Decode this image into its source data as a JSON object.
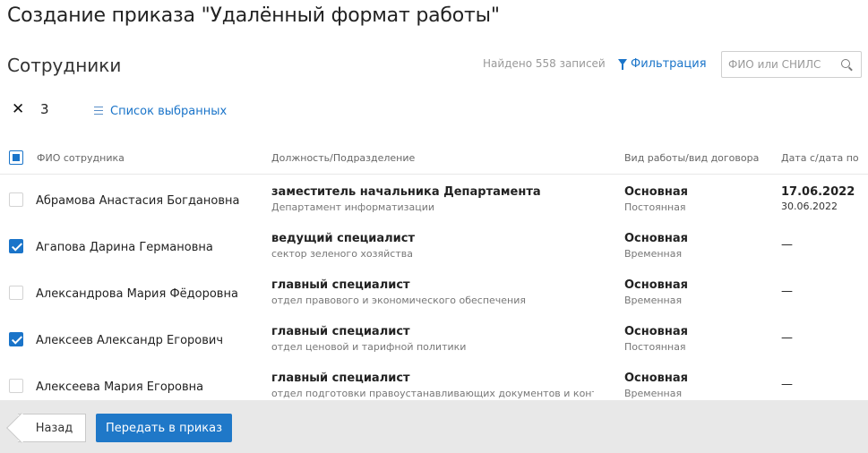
{
  "page": {
    "title": "Создание приказа \"Удалённый формат работы\"",
    "section_title": "Сотрудники"
  },
  "toolbar": {
    "found_text": "Найдено 558 записей",
    "filter_label": "Фильтрация",
    "search_placeholder": "ФИО или СНИЛС",
    "selected_count": "3",
    "selected_list_label": "Список выбранных"
  },
  "table": {
    "headers": {
      "name": "ФИО сотрудника",
      "position": "Должность/Подразделение",
      "work_type": "Вид работы/вид договора",
      "dates": "Дата с/дата по"
    },
    "rows": [
      {
        "checked": false,
        "name": "Абрамова Анастасия Богдановна",
        "position": "заместитель начальника Департамента",
        "department": "Департамент информатизации",
        "work_type": "Основная",
        "contract": "Постоянная",
        "date_from": "17.06.2022",
        "date_to": "30.06.2022"
      },
      {
        "checked": true,
        "name": "Агапова Дарина Германовна",
        "position": "ведущий специалист",
        "department": "сектор зеленого хозяйства",
        "work_type": "Основная",
        "contract": "Временная",
        "date_from": "—"
      },
      {
        "checked": false,
        "name": "Александрова Мария Фёдоровна",
        "position": "главный специалист",
        "department": "отдел правового и экономического обеспечения",
        "work_type": "Основная",
        "contract": "Временная",
        "date_from": "—"
      },
      {
        "checked": true,
        "name": "Алексеев Александр Егорович",
        "position": "главный специалист",
        "department": "отдел ценовой и тарифной политики",
        "work_type": "Основная",
        "contract": "Постоянная",
        "date_from": "—"
      },
      {
        "checked": false,
        "name": "Алексеева Мария Егоровна",
        "position": "главный специалист",
        "department": "отдел подготовки правоустанавливающих документов и конт...",
        "work_type": "Основная",
        "contract": "Временная",
        "date_from": "—"
      }
    ]
  },
  "footer": {
    "back_label": "Назад",
    "submit_label": "Передать в приказ"
  },
  "colors": {
    "accent": "#1a74c9",
    "footer_bg": "#e8e8e8"
  }
}
